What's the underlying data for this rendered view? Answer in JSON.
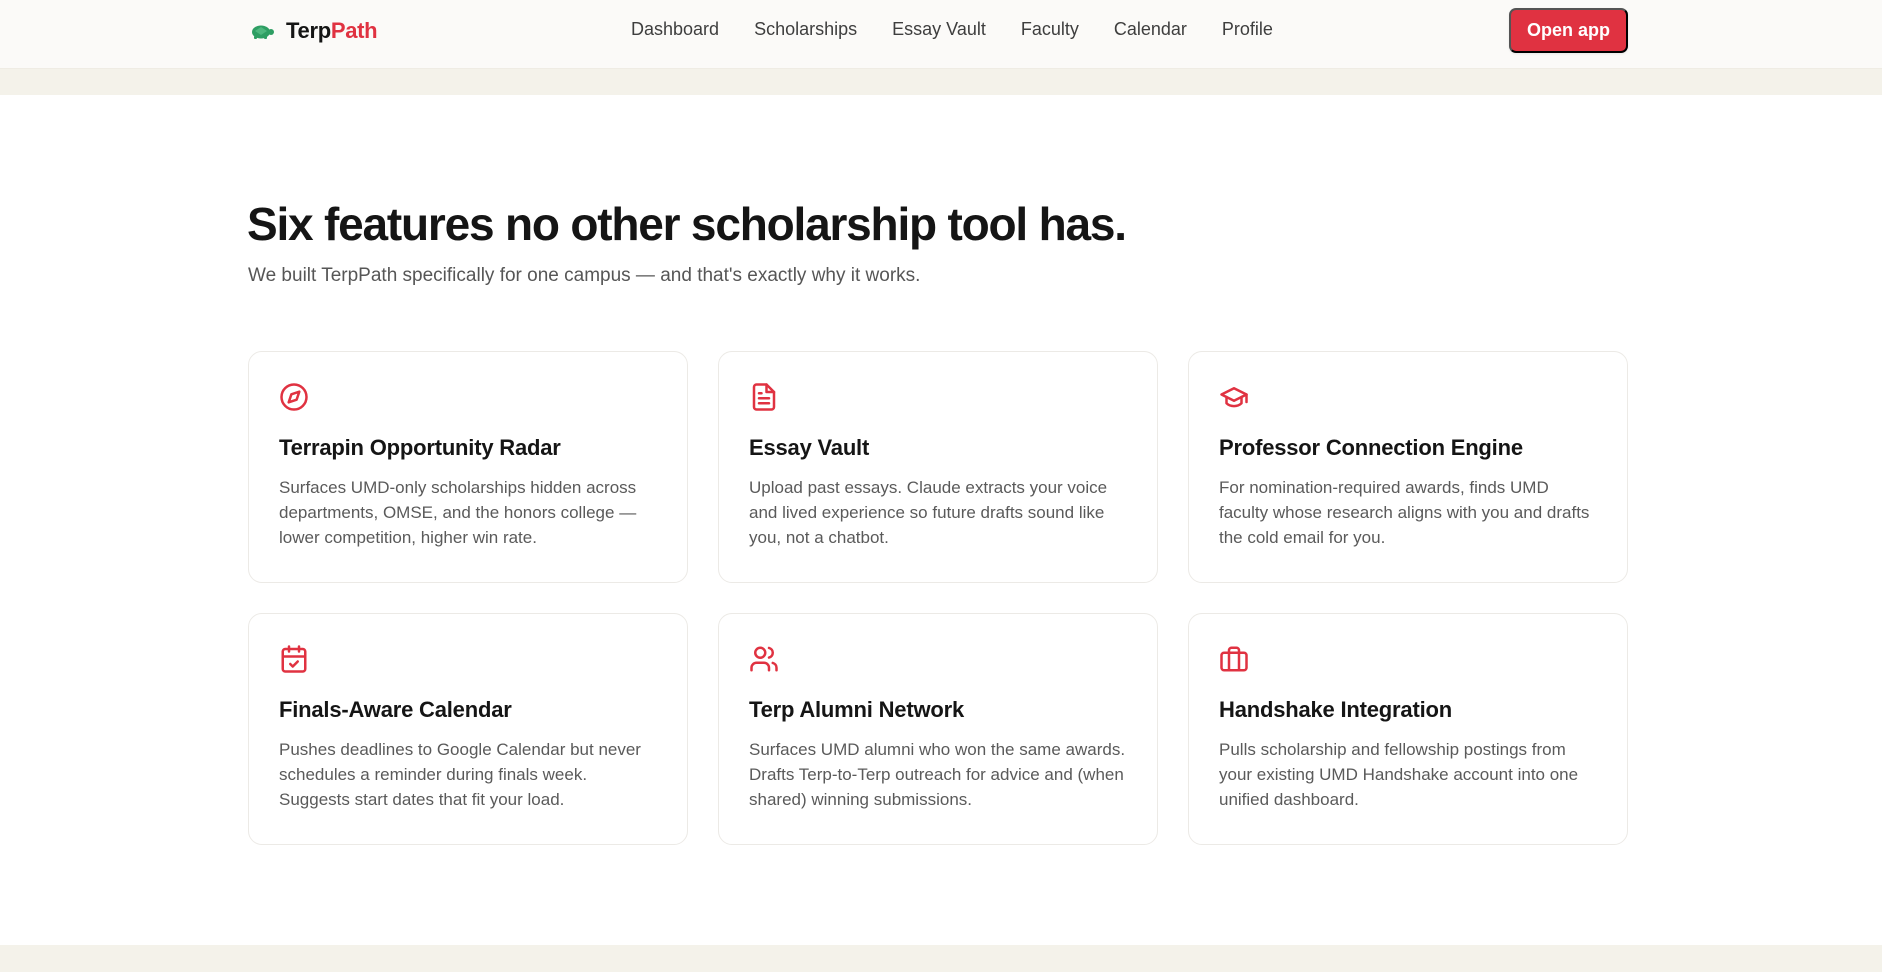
{
  "brand": {
    "name_part1": "Terp",
    "name_part2": "Path",
    "logo_icon": "turtle-icon"
  },
  "nav": {
    "items": [
      {
        "label": "Dashboard"
      },
      {
        "label": "Scholarships"
      },
      {
        "label": "Essay Vault"
      },
      {
        "label": "Faculty"
      },
      {
        "label": "Calendar"
      },
      {
        "label": "Profile"
      }
    ]
  },
  "header": {
    "open_app_label": "Open app"
  },
  "features": {
    "heading": "Six features no other scholarship tool has.",
    "subheading": "We built TerpPath specifically for one campus — and that's exactly why it works.",
    "cards": [
      {
        "icon": "compass-icon",
        "title": "Terrapin Opportunity Radar",
        "desc": "Surfaces UMD-only scholarships hidden across departments, OMSE, and the honors college — lower competition, higher win rate."
      },
      {
        "icon": "document-icon",
        "title": "Essay Vault",
        "desc": "Upload past essays. Claude extracts your voice and lived experience so future drafts sound like you, not a chatbot."
      },
      {
        "icon": "graduation-cap-icon",
        "title": "Professor Connection Engine",
        "desc": "For nomination-required awards, finds UMD faculty whose research aligns with you and drafts the cold email for you."
      },
      {
        "icon": "calendar-check-icon",
        "title": "Finals-Aware Calendar",
        "desc": "Pushes deadlines to Google Calendar but never schedules a reminder during finals week. Suggests start dates that fit your load."
      },
      {
        "icon": "users-icon",
        "title": "Terp Alumni Network",
        "desc": "Surfaces UMD alumni who won the same awards. Drafts Terp-to-Terp outreach for advice and (when shared) winning submissions."
      },
      {
        "icon": "briefcase-icon",
        "title": "Handshake Integration",
        "desc": "Pulls scholarship and fellowship postings from your existing UMD Handshake account into one unified dashboard."
      }
    ]
  },
  "colors": {
    "accent": "#e03241",
    "heading": "#151515",
    "muted": "#5a5a5a",
    "band": "#f4f2ea",
    "logo_green": "#2e9e63"
  }
}
